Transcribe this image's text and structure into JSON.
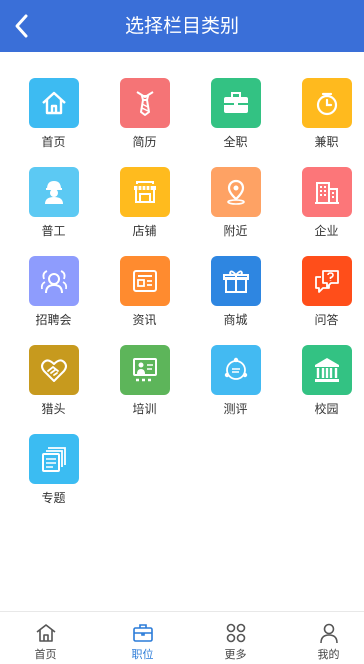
{
  "header": {
    "title": "选择栏目类别",
    "back_icon": "chevron-left-icon"
  },
  "categories": [
    {
      "label": "首页",
      "icon": "home-icon",
      "color": "#3dbbf2"
    },
    {
      "label": "简历",
      "icon": "tie-icon",
      "color": "#f57476"
    },
    {
      "label": "全职",
      "icon": "briefcase-icon",
      "color": "#33c283"
    },
    {
      "label": "兼职",
      "icon": "clock-icon",
      "color": "#ffba1e"
    },
    {
      "label": "普工",
      "icon": "worker-icon",
      "color": "#5cc9f3"
    },
    {
      "label": "店铺",
      "icon": "shop-icon",
      "color": "#ffbb1e"
    },
    {
      "label": "附近",
      "icon": "location-pin-icon",
      "color": "#fea264"
    },
    {
      "label": "企业",
      "icon": "building-icon",
      "color": "#fc7679"
    },
    {
      "label": "招聘会",
      "icon": "people-icon",
      "color": "#8e9cfd"
    },
    {
      "label": "资讯",
      "icon": "news-icon",
      "color": "#ff8b2f"
    },
    {
      "label": "商城",
      "icon": "gift-icon",
      "color": "#2e86e1"
    },
    {
      "label": "问答",
      "icon": "chat-question-icon",
      "color": "#ff4e1a"
    },
    {
      "label": "猎头",
      "icon": "handshake-heart-icon",
      "color": "#c79a1e"
    },
    {
      "label": "培训",
      "icon": "presentation-icon",
      "color": "#5db55a"
    },
    {
      "label": "测评",
      "icon": "assessment-icon",
      "color": "#43baf2"
    },
    {
      "label": "校园",
      "icon": "campus-icon",
      "color": "#33c283"
    },
    {
      "label": "专题",
      "icon": "topic-doc-icon",
      "color": "#3bbcf2"
    }
  ],
  "tabbar": {
    "active_color": "#2a7bd8",
    "items": [
      {
        "label": "首页",
        "icon": "home-icon"
      },
      {
        "label": "职位",
        "icon": "briefcase-icon"
      },
      {
        "label": "更多",
        "icon": "grid-icon"
      },
      {
        "label": "我的",
        "icon": "user-icon"
      }
    ]
  }
}
